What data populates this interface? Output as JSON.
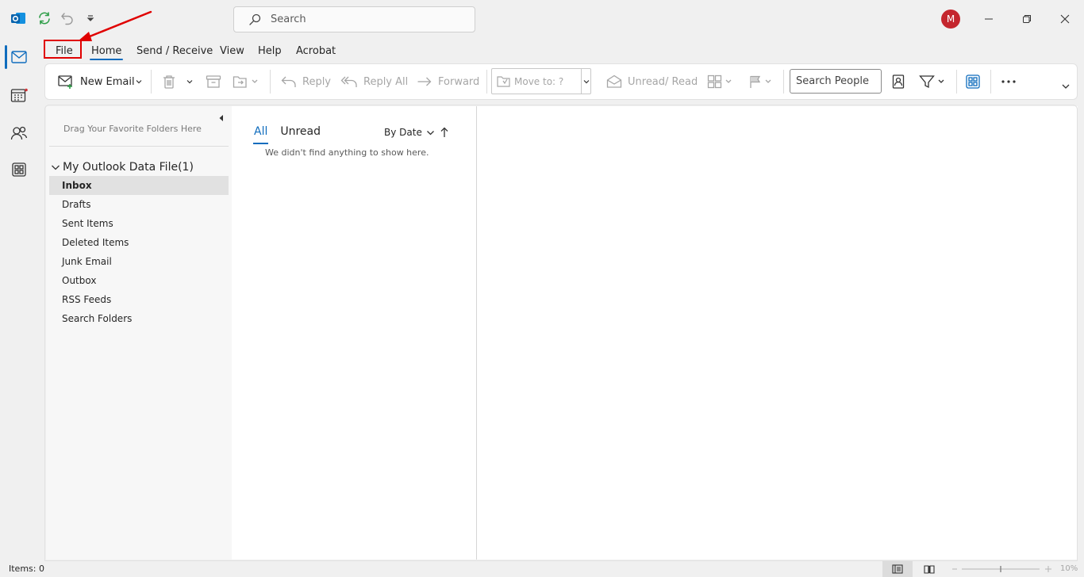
{
  "titlebar": {
    "search_placeholder": "Search",
    "avatar_initial": "M"
  },
  "ribbon_tabs": [
    "File",
    "Home",
    "Send / Receive",
    "View",
    "Help",
    "Acrobat"
  ],
  "ribbon": {
    "new_email": "New Email",
    "reply": "Reply",
    "reply_all": "Reply All",
    "forward": "Forward",
    "move_to": "Move to: ?",
    "unread_read": "Unread/ Read",
    "search_people": "Search People"
  },
  "folder_pane": {
    "favorites_hint": "Drag Your Favorite Folders Here",
    "account": "My Outlook Data File(1)",
    "folders": [
      "Inbox",
      "Drafts",
      "Sent Items",
      "Deleted Items",
      "Junk Email",
      "Outbox",
      "RSS Feeds",
      "Search Folders"
    ],
    "selected_folder": "Inbox"
  },
  "message_list": {
    "tabs": [
      "All",
      "Unread"
    ],
    "active_tab": "All",
    "sort_label": "By Date",
    "empty_message": "We didn't find anything to show here."
  },
  "status_bar": {
    "items": "Items: 0",
    "zoom": "10%"
  },
  "colors": {
    "accent": "#0f6cbd",
    "avatar_bg": "#c4262e",
    "annotation": "#e00000"
  },
  "icons": {
    "app": "outlook-icon",
    "sync": "sync-icon",
    "undo": "undo-icon",
    "qat": "customize-quick-access-icon",
    "mail": "mail-icon",
    "calendar": "calendar-icon",
    "people": "people-icon",
    "apps": "apps-icon"
  }
}
